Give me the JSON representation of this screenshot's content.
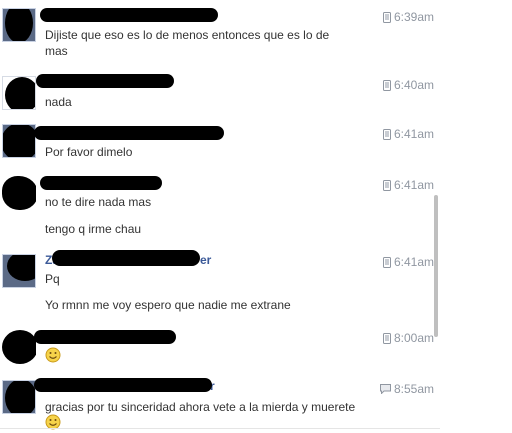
{
  "messages": [
    {
      "time": "6:39am",
      "device": "mobile",
      "name_fragment": "",
      "lines": [
        "Dijiste que eso es lo de menos entonces que es lo de",
        "mas"
      ],
      "emoji": null
    },
    {
      "time": "6:40am",
      "device": "mobile",
      "name_fragment": "",
      "lines": [
        "nada"
      ],
      "emoji": null
    },
    {
      "time": "6:41am",
      "device": "mobile",
      "name_fragment": "",
      "lines": [
        "Por favor dimelo"
      ],
      "emoji": null
    },
    {
      "time": "6:41am",
      "device": "mobile",
      "name_fragment": "",
      "lines": [
        "no te dire nada mas",
        "tengo q irme chau"
      ],
      "emoji": null
    },
    {
      "time": "6:41am",
      "device": "mobile",
      "name_fragment": "Za",
      "name_fragment_end": "er",
      "lines": [
        "Pq",
        "Yo rmnn me voy espero que nadie me extrane"
      ],
      "emoji": null
    },
    {
      "time": "8:00am",
      "device": "mobile",
      "name_fragment": "",
      "lines": [],
      "emoji": "smiley-emoji"
    },
    {
      "time": "8:55am",
      "device": "chat",
      "name_fragment": "",
      "name_fragment_end": "r",
      "lines": [
        "gracias por tu sinceridad ahora vete a la mierda y muerete"
      ],
      "emoji": "smiley-emoji"
    }
  ],
  "colors": {
    "name_link": "#3b5998",
    "timestamp": "#9097a1",
    "text": "#333333",
    "redaction": "#000000"
  }
}
